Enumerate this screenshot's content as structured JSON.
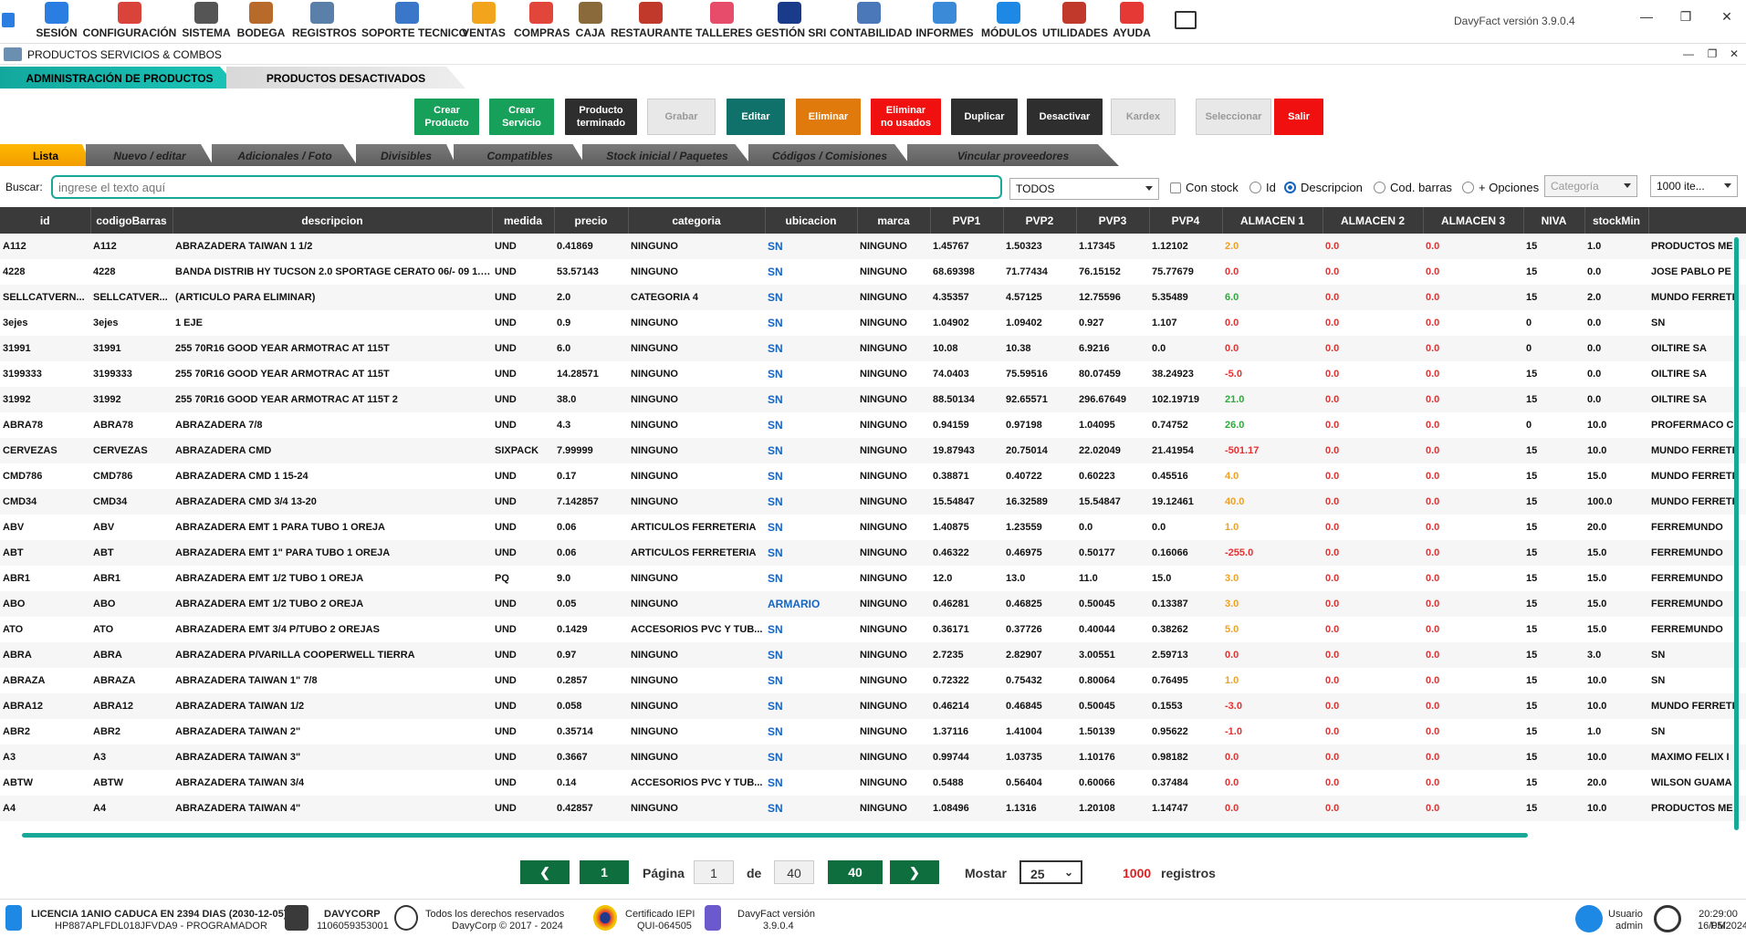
{
  "menu": [
    {
      "label": "SESIÓN",
      "icon": "user-icon",
      "color": "#2a7de1"
    },
    {
      "label": "CONFIGURACIÓN",
      "icon": "gears-icon",
      "color": "#d9433a"
    },
    {
      "label": "SISTEMA",
      "icon": "monitor-icon",
      "color": "#555"
    },
    {
      "label": "BODEGA",
      "icon": "warehouse-icon",
      "color": "#b86a2a"
    },
    {
      "label": "REGISTROS",
      "icon": "registry-icon",
      "color": "#5a7fa8"
    },
    {
      "label": "SOPORTE TECNICO",
      "icon": "support-icon",
      "color": "#3a77c9"
    },
    {
      "label": "VENTAS",
      "icon": "sales-icon",
      "color": "#f2a51c"
    },
    {
      "label": "COMPRAS",
      "icon": "cart-icon",
      "color": "#e2453a"
    },
    {
      "label": "CAJA",
      "icon": "cash-register-icon",
      "color": "#8a6a3a"
    },
    {
      "label": "RESTAURANTE",
      "icon": "restaurant-icon",
      "color": "#c0392b"
    },
    {
      "label": "TALLERES",
      "icon": "workshop-icon",
      "color": "#e74c6b"
    },
    {
      "label": "GESTIÓN SRI",
      "icon": "sri-icon",
      "color": "#1a3a8a"
    },
    {
      "label": "CONTABILIDAD",
      "icon": "accounting-icon",
      "color": "#4a78b8"
    },
    {
      "label": "INFORMES",
      "icon": "chart-icon",
      "color": "#3a8ad8"
    },
    {
      "label": "MÓDULOS",
      "icon": "modules-icon",
      "color": "#1e88e5"
    },
    {
      "label": "UTILIDADES",
      "icon": "utilities-icon",
      "color": "#c0392b"
    },
    {
      "label": "AYUDA",
      "icon": "help-icon",
      "color": "#e53935"
    }
  ],
  "app_version": "DavyFact versión 3.9.0.4",
  "window_title": "PRODUCTOS SERVICIOS & COMBOS",
  "top_tabs": [
    "ADMINISTRACIÓN DE PRODUCTOS",
    "PRODUCTOS DESACTIVADOS"
  ],
  "actions": [
    {
      "label": "Crear Producto",
      "l1": "Crear",
      "l2": "Producto",
      "cls": "g"
    },
    {
      "label": "Crear Servicio",
      "l1": "Crear",
      "l2": "Servicio",
      "cls": "g"
    },
    {
      "label": "Producto terminado",
      "l1": "Producto",
      "l2": "terminado",
      "cls": "k"
    },
    {
      "label": "Grabar",
      "l1": "Grabar",
      "l2": "",
      "cls": "dis"
    },
    {
      "label": "Editar",
      "l1": "Editar",
      "l2": "",
      "cls": "tl"
    },
    {
      "label": "Eliminar",
      "l1": "Eliminar",
      "l2": "",
      "cls": "or"
    },
    {
      "label": "Eliminar no usados",
      "l1": "Eliminar",
      "l2": "no usados",
      "cls": "rd"
    },
    {
      "label": "Duplicar",
      "l1": "Duplicar",
      "l2": "",
      "cls": "k"
    },
    {
      "label": "Desactivar",
      "l1": "Desactivar",
      "l2": "",
      "cls": "k"
    },
    {
      "label": "Kardex",
      "l1": "Kardex",
      "l2": "",
      "cls": "dis"
    },
    {
      "label": "Seleccionar",
      "l1": "Seleccionar",
      "l2": "",
      "cls": "dis"
    },
    {
      "label": "Salir",
      "l1": "Salir",
      "l2": "",
      "cls": "rd"
    }
  ],
  "sub_tabs": [
    "Lista",
    "Nuevo / editar",
    "Adicionales / Foto",
    "Divisibles",
    "Compatibles",
    "Stock inicial / Paquetes",
    "Códigos / Comisiones",
    "Vincular proveedores"
  ],
  "search": {
    "label": "Buscar:",
    "placeholder": "ingrese el texto aquí",
    "filter": "TODOS",
    "category_placeholder": "Categoría",
    "page_size": "1000 ite...",
    "options": [
      "Con stock",
      "Id",
      "Descripcion",
      "Cod. barras",
      "+ Opciones"
    ]
  },
  "columns": [
    "id",
    "codigoBarras",
    "descripcion",
    "medida",
    "precio",
    "categoria",
    "ubicacion",
    "marca",
    "PVP1",
    "PVP2",
    "PVP3",
    "PVP4",
    "ALMACEN 1",
    "ALMACEN 2",
    "ALMACEN 3",
    "NIVA",
    "stockMin",
    ""
  ],
  "rows": [
    [
      "A112",
      "A112",
      "ABRAZADERA TAIWAN 1 1/2",
      "UND",
      "0.41869",
      "NINGUNO",
      "SN",
      "NINGUNO",
      "1.45767",
      "1.50323",
      "1.17345",
      "1.12102",
      "2.0",
      "0.0",
      "0.0",
      "15",
      "1.0",
      "PRODUCTOS ME"
    ],
    [
      "4228",
      "4228",
      "BANDA DISTRIB HY TUCSON 2.0 SPORTAGE CERATO 06/- 09 1.8 ...",
      "UND",
      "53.57143",
      "NINGUNO",
      "SN",
      "NINGUNO",
      "68.69398",
      "71.77434",
      "76.15152",
      "75.77679",
      "0.0",
      "0.0",
      "0.0",
      "15",
      "0.0",
      "JOSE PABLO PE"
    ],
    [
      "SELLCATVERN...",
      "SELLCATVER...",
      "(ARTICULO PARA ELIMINAR)",
      "UND",
      "2.0",
      "CATEGORIA 4",
      "SN",
      "NINGUNO",
      "4.35357",
      "4.57125",
      "12.75596",
      "5.35489",
      "6.0",
      "0.0",
      "0.0",
      "15",
      "2.0",
      "MUNDO FERRETI"
    ],
    [
      "3ejes",
      "3ejes",
      "1 EJE",
      "UND",
      "0.9",
      "NINGUNO",
      "SN",
      "NINGUNO",
      "1.04902",
      "1.09402",
      "0.927",
      "1.107",
      "0.0",
      "0.0",
      "0.0",
      "0",
      "0.0",
      "SN"
    ],
    [
      "31991",
      "31991",
      "255 70R16 GOOD YEAR ARMOTRAC AT 115T",
      "UND",
      "6.0",
      "NINGUNO",
      "SN",
      "NINGUNO",
      "10.08",
      "10.38",
      "6.9216",
      "0.0",
      "0.0",
      "0.0",
      "0.0",
      "0",
      "0.0",
      "OILTIRE SA"
    ],
    [
      "3199333",
      "3199333",
      "255 70R16 GOOD YEAR ARMOTRAC AT 115T",
      "UND",
      "14.28571",
      "NINGUNO",
      "SN",
      "NINGUNO",
      "74.0403",
      "75.59516",
      "80.07459",
      "38.24923",
      "-5.0",
      "0.0",
      "0.0",
      "15",
      "0.0",
      "OILTIRE SA"
    ],
    [
      "31992",
      "31992",
      "255 70R16 GOOD YEAR ARMOTRAC AT 115T 2",
      "UND",
      "38.0",
      "NINGUNO",
      "SN",
      "NINGUNO",
      "88.50134",
      "92.65571",
      "296.67649",
      "102.19719",
      "21.0",
      "0.0",
      "0.0",
      "15",
      "0.0",
      "OILTIRE SA"
    ],
    [
      "ABRA78",
      "ABRA78",
      "ABRAZADERA 7/8",
      "UND",
      "4.3",
      "NINGUNO",
      "SN",
      "NINGUNO",
      "0.94159",
      "0.97198",
      "1.04095",
      "0.74752",
      "26.0",
      "0.0",
      "0.0",
      "0",
      "10.0",
      "PROFERMACO C"
    ],
    [
      "CERVEZAS",
      "CERVEZAS",
      "ABRAZADERA CMD",
      "SIXPACK",
      "7.99999",
      "NINGUNO",
      "SN",
      "NINGUNO",
      "19.87943",
      "20.75014",
      "22.02049",
      "21.41954",
      "-501.17",
      "0.0",
      "0.0",
      "15",
      "10.0",
      "MUNDO FERRETI"
    ],
    [
      "CMD786",
      "CMD786",
      "ABRAZADERA CMD 1 15-24",
      "UND",
      "0.17",
      "NINGUNO",
      "SN",
      "NINGUNO",
      "0.38871",
      "0.40722",
      "0.60223",
      "0.45516",
      "4.0",
      "0.0",
      "0.0",
      "15",
      "15.0",
      "MUNDO FERRETI"
    ],
    [
      "CMD34",
      "CMD34",
      "ABRAZADERA CMD 3/4  13-20",
      "UND",
      "7.142857",
      "NINGUNO",
      "SN",
      "NINGUNO",
      "15.54847",
      "16.32589",
      "15.54847",
      "19.12461",
      "40.0",
      "0.0",
      "0.0",
      "15",
      "100.0",
      "MUNDO FERRETI"
    ],
    [
      "ABV",
      "ABV",
      "ABRAZADERA EMT 1 PARA TUBO 1 OREJA",
      "UND",
      "0.06",
      "ARTICULOS FERRETERIA",
      "SN",
      "NINGUNO",
      "1.40875",
      "1.23559",
      "0.0",
      "0.0",
      "1.0",
      "0.0",
      "0.0",
      "15",
      "20.0",
      "FERREMUNDO"
    ],
    [
      "ABT",
      "ABT",
      "ABRAZADERA EMT 1\" PARA TUBO 1 OREJA",
      "UND",
      "0.06",
      "ARTICULOS FERRETERIA",
      "SN",
      "NINGUNO",
      "0.46322",
      "0.46975",
      "0.50177",
      "0.16066",
      "-255.0",
      "0.0",
      "0.0",
      "15",
      "15.0",
      "FERREMUNDO"
    ],
    [
      "ABR1",
      "ABR1",
      "ABRAZADERA EMT 1/2 TUBO 1 OREJA",
      "PQ",
      "9.0",
      "NINGUNO",
      "SN",
      "NINGUNO",
      "12.0",
      "13.0",
      "11.0",
      "15.0",
      "3.0",
      "0.0",
      "0.0",
      "15",
      "15.0",
      "FERREMUNDO"
    ],
    [
      "ABO",
      "ABO",
      "ABRAZADERA EMT 1/2 TUBO 2 OREJA",
      "UND",
      "0.05",
      "NINGUNO",
      "ARMARIO",
      "NINGUNO",
      "0.46281",
      "0.46825",
      "0.50045",
      "0.13387",
      "3.0",
      "0.0",
      "0.0",
      "15",
      "15.0",
      "FERREMUNDO"
    ],
    [
      "ATO",
      "ATO",
      "ABRAZADERA EMT 3/4 P/TUBO 2 OREJAS",
      "UND",
      "0.1429",
      "ACCESORIOS PVC Y TUB...",
      "SN",
      "NINGUNO",
      "0.36171",
      "0.37726",
      "0.40044",
      "0.38262",
      "5.0",
      "0.0",
      "0.0",
      "15",
      "15.0",
      "FERREMUNDO"
    ],
    [
      "ABRA",
      "ABRA",
      "ABRAZADERA P/VARILLA COOPERWELL TIERRA",
      "UND",
      "0.97",
      "NINGUNO",
      "SN",
      "NINGUNO",
      "2.7235",
      "2.82907",
      "3.00551",
      "2.59713",
      "0.0",
      "0.0",
      "0.0",
      "15",
      "3.0",
      "SN"
    ],
    [
      "ABRAZA",
      "ABRAZA",
      "ABRAZADERA TAIWAN 1\" 7/8",
      "UND",
      "0.2857",
      "NINGUNO",
      "SN",
      "NINGUNO",
      "0.72322",
      "0.75432",
      "0.80064",
      "0.76495",
      "1.0",
      "0.0",
      "0.0",
      "15",
      "10.0",
      "SN"
    ],
    [
      "ABRA12",
      "ABRA12",
      "ABRAZADERA TAIWAN 1/2",
      "UND",
      "0.058",
      "NINGUNO",
      "SN",
      "NINGUNO",
      "0.46214",
      "0.46845",
      "0.50045",
      "0.1553",
      "-3.0",
      "0.0",
      "0.0",
      "15",
      "10.0",
      "MUNDO FERRETI"
    ],
    [
      "ABR2",
      "ABR2",
      "ABRAZADERA TAIWAN 2\"",
      "UND",
      "0.35714",
      "NINGUNO",
      "SN",
      "NINGUNO",
      "1.37116",
      "1.41004",
      "1.50139",
      "0.95622",
      "-1.0",
      "0.0",
      "0.0",
      "15",
      "1.0",
      "SN"
    ],
    [
      "A3",
      "A3",
      "ABRAZADERA TAIWAN 3\"",
      "UND",
      "0.3667",
      "NINGUNO",
      "SN",
      "NINGUNO",
      "0.99744",
      "1.03735",
      "1.10176",
      "0.98182",
      "0.0",
      "0.0",
      "0.0",
      "15",
      "10.0",
      "MAXIMO FELIX I"
    ],
    [
      "ABTW",
      "ABTW",
      "ABRAZADERA TAIWAN 3/4",
      "UND",
      "0.14",
      "ACCESORIOS PVC Y TUB...",
      "SN",
      "NINGUNO",
      "0.5488",
      "0.56404",
      "0.60066",
      "0.37484",
      "0.0",
      "0.0",
      "0.0",
      "15",
      "20.0",
      "WILSON GUAMA"
    ],
    [
      "A4",
      "A4",
      "ABRAZADERA TAIWAN 4\"",
      "UND",
      "0.42857",
      "NINGUNO",
      "SN",
      "NINGUNO",
      "1.08496",
      "1.1316",
      "1.20108",
      "1.14747",
      "0.0",
      "0.0",
      "0.0",
      "15",
      "10.0",
      "PRODUCTOS ME"
    ]
  ],
  "pager": {
    "current": "1",
    "page_label": "Página",
    "page_value": "1",
    "of_label": "de",
    "total": "40",
    "last": "40",
    "show_label": "Mostar",
    "page_size": "25",
    "count": "1000",
    "count_label": "registros"
  },
  "footer": {
    "license": "LICENCIA 1ANIO CADUCA EN 2394 DIAS (2030-12-05)",
    "license_code": "HP887APLFDL018JFVDA9 - PROGRAMADOR",
    "company": "DAVYCORP",
    "company_id": "1106059353001",
    "rights": "Todos los derechos reservados",
    "copyright": "DavyCorp © 2017 - 2024",
    "cert": "Certificado IEPI",
    "cert_code": "QUI-064505",
    "ver_label": "DavyFact versión",
    "ver": "3.9.0.4",
    "user_label": "Usuario",
    "user": "admin",
    "time": "20:29:00 PM",
    "date": "16/05/2024"
  }
}
